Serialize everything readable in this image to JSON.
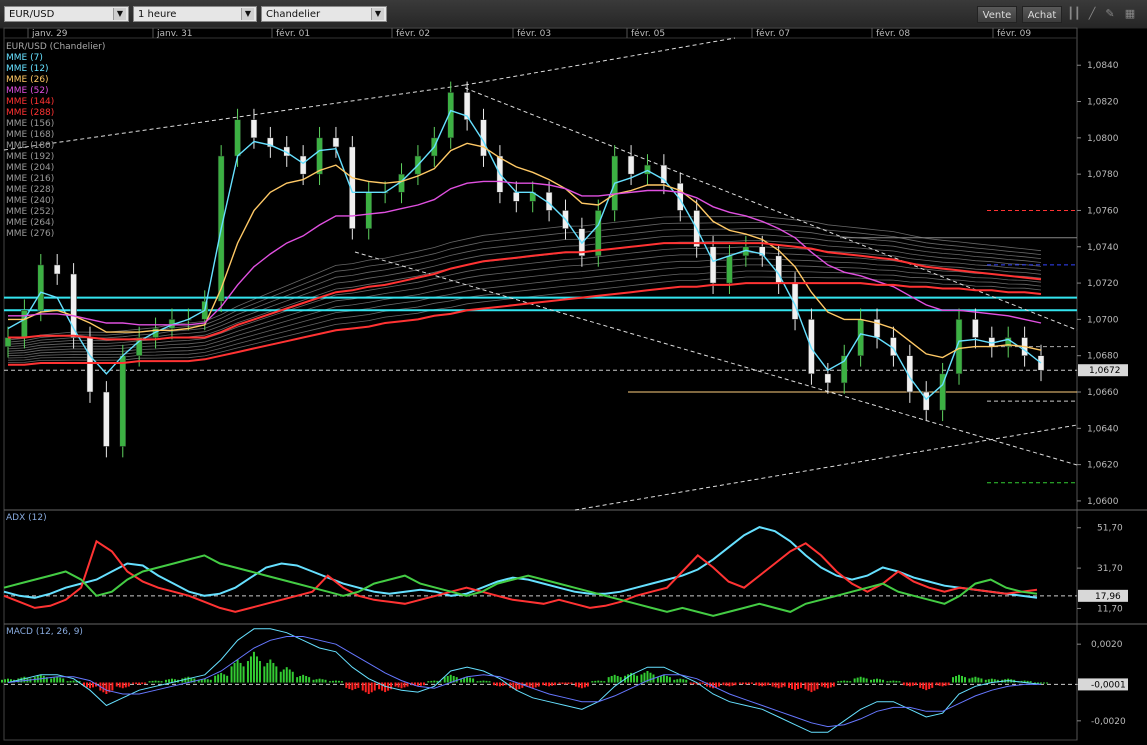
{
  "toolbar": {
    "symbol": "EUR/USD",
    "interval": "1 heure",
    "chart_type": "Chandelier",
    "sell_label": "Vente",
    "buy_label": "Achat",
    "icons": [
      "bars-icon",
      "line-icon",
      "draw-icon",
      "grid-icon"
    ]
  },
  "date_labels": [
    "janv. 29",
    "janv. 31",
    "févr. 01",
    "févr. 02",
    "févr. 03",
    "févr. 05",
    "févr. 07",
    "févr. 08",
    "févr. 09"
  ],
  "legend": {
    "title": "EUR/USD (Chandelier)",
    "items": [
      {
        "label": "MME (7)",
        "color": "#66e0ff"
      },
      {
        "label": "MME (12)",
        "color": "#66e0ff"
      },
      {
        "label": "MME (26)",
        "color": "#ffc966"
      },
      {
        "label": "MME (52)",
        "color": "#e050e0"
      },
      {
        "label": "MME (144)",
        "color": "#ff3333"
      },
      {
        "label": "MME (288)",
        "color": "#ff3333"
      },
      {
        "label": "MME (156)",
        "color": "#999999"
      },
      {
        "label": "MME (168)",
        "color": "#999999"
      },
      {
        "label": "MME (180)",
        "color": "#999999"
      },
      {
        "label": "MME (192)",
        "color": "#999999"
      },
      {
        "label": "MME (204)",
        "color": "#999999"
      },
      {
        "label": "MME (216)",
        "color": "#999999"
      },
      {
        "label": "MME (228)",
        "color": "#999999"
      },
      {
        "label": "MME (240)",
        "color": "#999999"
      },
      {
        "label": "MME (252)",
        "color": "#999999"
      },
      {
        "label": "MME (264)",
        "color": "#999999"
      },
      {
        "label": "MME (276)",
        "color": "#999999"
      }
    ]
  },
  "chart_data": [
    {
      "type": "line",
      "title": "EUR/USD (Chandelier)",
      "ylim": [
        1.0595,
        1.0855
      ],
      "y_ticks": [
        "1,0840",
        "1,0820",
        "1,0800",
        "1,0780",
        "1,0760",
        "1,0740",
        "1,0720",
        "1,0700",
        "1,0680",
        "1,0660",
        "1,0640",
        "1,0620",
        "1,0600"
      ],
      "current_price_label": "1,0672",
      "current_price": 1.0672,
      "closes": [
        1.069,
        1.0705,
        1.073,
        1.0725,
        1.069,
        1.066,
        1.063,
        1.068,
        1.069,
        1.0695,
        1.07,
        1.07,
        1.071,
        1.079,
        1.081,
        1.08,
        1.0795,
        1.079,
        1.078,
        1.08,
        1.0795,
        1.075,
        1.077,
        1.077,
        1.078,
        1.079,
        1.08,
        1.0825,
        1.081,
        1.079,
        1.077,
        1.0765,
        1.077,
        1.076,
        1.075,
        1.0735,
        1.076,
        1.079,
        1.078,
        1.0785,
        1.0775,
        1.076,
        1.074,
        1.072,
        1.0735,
        1.074,
        1.0735,
        1.072,
        1.07,
        1.067,
        1.0665,
        1.068,
        1.07,
        1.069,
        1.068,
        1.066,
        1.065,
        1.067,
        1.07,
        1.069,
        1.0685,
        1.069,
        1.068,
        1.0672
      ],
      "series_ema": [
        {
          "label": "MME (7)",
          "color": "#66e0ff",
          "values": [
            1.0695,
            1.07,
            1.0715,
            1.0712,
            1.0695,
            1.068,
            1.067,
            1.068,
            1.0688,
            1.0693,
            1.0697,
            1.07,
            1.0705,
            1.075,
            1.079,
            1.0798,
            1.0796,
            1.0792,
            1.0786,
            1.0793,
            1.0794,
            1.077,
            1.077,
            1.077,
            1.0776,
            1.0785,
            1.0795,
            1.0815,
            1.0812,
            1.0798,
            1.078,
            1.077,
            1.077,
            1.0764,
            1.0755,
            1.0742,
            1.0752,
            1.0775,
            1.0778,
            1.0782,
            1.0777,
            1.0766,
            1.075,
            1.0732,
            1.0735,
            1.0738,
            1.0736,
            1.0725,
            1.0708,
            1.0684,
            1.0672,
            1.0677,
            1.0692,
            1.069,
            1.0684,
            1.0668,
            1.0656,
            1.0664,
            1.0688,
            1.0689,
            1.0687,
            1.0689,
            1.0683,
            1.0676
          ]
        },
        {
          "label": "MME (26)",
          "color": "#ffc966",
          "values": [
            1.07,
            1.07,
            1.0704,
            1.0705,
            1.0702,
            1.0698,
            1.0693,
            1.0693,
            1.0693,
            1.0694,
            1.0694,
            1.0695,
            1.0697,
            1.0717,
            1.0742,
            1.076,
            1.077,
            1.0775,
            1.0777,
            1.0782,
            1.0785,
            1.0778,
            1.0776,
            1.0775,
            1.0776,
            1.0779,
            1.0783,
            1.0793,
            1.0797,
            1.0795,
            1.0789,
            1.0784,
            1.0781,
            1.0777,
            1.0772,
            1.0764,
            1.0763,
            1.0769,
            1.0771,
            1.0774,
            1.0774,
            1.0771,
            1.0764,
            1.0754,
            1.0749,
            1.0747,
            1.0744,
            1.0738,
            1.0729,
            1.0715,
            1.0704,
            1.07,
            1.07,
            1.0698,
            1.0695,
            1.0688,
            1.0681,
            1.0679,
            1.0684,
            1.0685,
            1.0685,
            1.0686,
            1.0685,
            1.0683
          ]
        },
        {
          "label": "MME (52)",
          "color": "#e050e0",
          "values": [
            1.0702,
            1.0702,
            1.0703,
            1.0703,
            1.0702,
            1.07,
            1.0698,
            1.0698,
            1.0697,
            1.0697,
            1.0697,
            1.0697,
            1.0698,
            1.0707,
            1.0719,
            1.0729,
            1.0736,
            1.0742,
            1.0746,
            1.0752,
            1.0757,
            1.0757,
            1.0758,
            1.0759,
            1.0761,
            1.0763,
            1.0766,
            1.0772,
            1.0775,
            1.0776,
            1.0776,
            1.0775,
            1.0775,
            1.0774,
            1.0772,
            1.0768,
            1.0768,
            1.0769,
            1.077,
            1.0771,
            1.0771,
            1.077,
            1.0767,
            1.0762,
            1.0759,
            1.0757,
            1.0754,
            1.075,
            1.0745,
            1.0737,
            1.073,
            1.0726,
            1.0724,
            1.0721,
            1.0718,
            1.0713,
            1.0708,
            1.0705,
            1.0705,
            1.0704,
            1.0703,
            1.0702,
            1.07,
            1.0698
          ]
        },
        {
          "label": "MME (144)",
          "color": "#ff3333",
          "values": [
            1.069,
            1.069,
            1.0691,
            1.0691,
            1.0691,
            1.069,
            1.0689,
            1.0689,
            1.0689,
            1.0689,
            1.069,
            1.069,
            1.069,
            1.0693,
            1.0697,
            1.07,
            1.0703,
            1.0706,
            1.0709,
            1.0712,
            1.0715,
            1.0716,
            1.0718,
            1.0719,
            1.0721,
            1.0723,
            1.0725,
            1.0728,
            1.073,
            1.0732,
            1.0733,
            1.0734,
            1.0735,
            1.0736,
            1.0737,
            1.0737,
            1.0738,
            1.0739,
            1.074,
            1.0741,
            1.0742,
            1.0742,
            1.0742,
            1.0742,
            1.0742,
            1.0742,
            1.0742,
            1.0741,
            1.074,
            1.0739,
            1.0737,
            1.0736,
            1.0735,
            1.0734,
            1.0733,
            1.0731,
            1.0729,
            1.0728,
            1.0727,
            1.0726,
            1.0725,
            1.0724,
            1.0723,
            1.0722
          ]
        },
        {
          "label": "MME (288)",
          "color": "#ff3333",
          "values": [
            1.0675,
            1.0675,
            1.0676,
            1.0676,
            1.0676,
            1.0676,
            1.0676,
            1.0676,
            1.0677,
            1.0677,
            1.0677,
            1.0677,
            1.0678,
            1.068,
            1.0682,
            1.0684,
            1.0686,
            1.0688,
            1.069,
            1.0692,
            1.0694,
            1.0695,
            1.0696,
            1.0698,
            1.0699,
            1.07,
            1.0702,
            1.0703,
            1.0705,
            1.0706,
            1.0707,
            1.0708,
            1.0709,
            1.071,
            1.0711,
            1.0712,
            1.0713,
            1.0714,
            1.0715,
            1.0716,
            1.0717,
            1.0718,
            1.0718,
            1.0719,
            1.0719,
            1.072,
            1.072,
            1.072,
            1.072,
            1.072,
            1.072,
            1.072,
            1.072,
            1.0719,
            1.0719,
            1.0718,
            1.0718,
            1.0717,
            1.0717,
            1.0716,
            1.0716,
            1.0715,
            1.0715,
            1.0714
          ]
        }
      ],
      "horizontal_levels": [
        {
          "value": 1.0712,
          "color": "#33e5f0",
          "style": "solid"
        },
        {
          "value": 1.0705,
          "color": "#33e5f0",
          "style": "solid"
        },
        {
          "value": 1.0745,
          "color": "#888888",
          "style": "solid"
        },
        {
          "value": 1.066,
          "color": "#ffd080",
          "style": "solid"
        },
        {
          "value": 1.0672,
          "color": "#cccccc",
          "style": "dashed"
        },
        {
          "value": 1.076,
          "color": "#ff3333",
          "style": "dashed"
        },
        {
          "value": 1.073,
          "color": "#3344ff",
          "style": "dashed"
        },
        {
          "value": 1.0685,
          "color": "#aaaaaa",
          "style": "dashed"
        },
        {
          "value": 1.0655,
          "color": "#cccccc",
          "style": "dashed"
        },
        {
          "value": 1.061,
          "color": "#33cc33",
          "style": "dashed"
        }
      ]
    },
    {
      "type": "line",
      "title": "ADX (12)",
      "ylim": [
        4,
        60
      ],
      "y_ticks": [
        "51,70",
        "31,70",
        "11,70"
      ],
      "current_value_label": "17,96",
      "series": [
        {
          "color": "#66e0ff",
          "values": [
            20,
            18,
            17,
            19,
            22,
            24,
            26,
            30,
            34,
            33,
            28,
            24,
            20,
            18,
            19,
            22,
            27,
            32,
            34,
            33,
            30,
            27,
            24,
            22,
            20,
            19,
            20,
            21,
            20,
            18,
            19,
            22,
            25,
            27,
            26,
            24,
            22,
            20,
            19,
            19,
            20,
            22,
            24,
            26,
            28,
            31,
            36,
            42,
            48,
            52,
            50,
            45,
            38,
            32,
            28,
            26,
            28,
            32,
            30,
            27,
            25,
            23,
            22,
            21,
            20,
            19,
            18,
            17
          ]
        },
        {
          "color": "#ff3333",
          "values": [
            18,
            15,
            12,
            13,
            16,
            22,
            45,
            40,
            30,
            25,
            22,
            20,
            18,
            15,
            12,
            10,
            12,
            14,
            16,
            18,
            20,
            28,
            22,
            18,
            16,
            15,
            14,
            16,
            18,
            20,
            22,
            20,
            18,
            16,
            15,
            14,
            16,
            14,
            12,
            13,
            15,
            18,
            20,
            22,
            30,
            38,
            32,
            25,
            22,
            28,
            34,
            40,
            44,
            38,
            30,
            24,
            20,
            24,
            30,
            25,
            22,
            20,
            22,
            21,
            20,
            19,
            20,
            21
          ]
        },
        {
          "color": "#44cc44",
          "values": [
            22,
            24,
            26,
            28,
            30,
            26,
            18,
            20,
            26,
            30,
            32,
            34,
            36,
            38,
            34,
            32,
            30,
            28,
            26,
            24,
            22,
            20,
            18,
            20,
            24,
            26,
            28,
            24,
            22,
            20,
            18,
            20,
            24,
            26,
            28,
            26,
            24,
            22,
            20,
            18,
            16,
            14,
            12,
            10,
            12,
            10,
            8,
            10,
            12,
            14,
            12,
            10,
            14,
            16,
            18,
            20,
            22,
            24,
            20,
            18,
            16,
            14,
            18,
            24,
            26,
            22,
            20,
            19
          ]
        }
      ]
    },
    {
      "type": "bar",
      "title": "MACD (12, 26, 9)",
      "ylim": [
        -0.003,
        0.003
      ],
      "y_ticks": [
        "0,0020",
        "-0,0001",
        "-0,0020"
      ],
      "current_value_label": "-0,0001",
      "histogram": [
        0.0002,
        0.0003,
        0.0004,
        0.0003,
        0.0001,
        -0.0003,
        -0.0006,
        -0.0003,
        -0.0001,
        0.0001,
        0.0002,
        0.0003,
        0.0002,
        0.0005,
        0.0012,
        0.0016,
        0.0012,
        0.0008,
        0.0004,
        0.0002,
        0.0001,
        -0.0004,
        -0.0006,
        -0.0005,
        -0.0003,
        -0.0002,
        0.0001,
        0.0004,
        0.0003,
        0.0001,
        -0.0002,
        -0.0004,
        -0.0003,
        -0.0002,
        -0.0001,
        -0.0003,
        0.0001,
        0.0004,
        0.0005,
        0.0006,
        0.0004,
        0.0002,
        -0.0001,
        -0.0003,
        -0.0002,
        -0.0001,
        -0.0002,
        -0.0003,
        -0.0004,
        -0.0005,
        -0.0003,
        0.0001,
        0.0003,
        0.0002,
        0.0001,
        -0.0002,
        -0.0004,
        -0.0002,
        0.0004,
        0.0003,
        0.0002,
        0.0002,
        0.0001,
        0.0
      ],
      "macd": [
        0.0,
        0.0002,
        0.0004,
        0.0004,
        0.0002,
        -0.0004,
        -0.0012,
        -0.0008,
        -0.0004,
        -0.0002,
        0.0,
        0.0002,
        0.0004,
        0.0012,
        0.0022,
        0.0028,
        0.0028,
        0.0026,
        0.0022,
        0.0018,
        0.0016,
        0.0008,
        0.0002,
        -0.0002,
        -0.0004,
        -0.0005,
        -0.0002,
        0.0006,
        0.0008,
        0.0006,
        0.0002,
        -0.0004,
        -0.0008,
        -0.001,
        -0.0012,
        -0.0014,
        -0.001,
        -0.0002,
        0.0004,
        0.0008,
        0.0008,
        0.0004,
        0.0,
        -0.0006,
        -0.001,
        -0.0012,
        -0.0014,
        -0.0018,
        -0.0022,
        -0.0026,
        -0.0026,
        -0.002,
        -0.0014,
        -0.001,
        -0.001,
        -0.0014,
        -0.0018,
        -0.0016,
        -0.0006,
        -0.0002,
        0.0,
        0.0001,
        0.0,
        -0.0001
      ],
      "signal": [
        0.0,
        0.0001,
        0.0002,
        0.0003,
        0.0003,
        0.0001,
        -0.0004,
        -0.0006,
        -0.0006,
        -0.0004,
        -0.0002,
        0.0,
        0.0002,
        0.0006,
        0.0012,
        0.0018,
        0.0022,
        0.0024,
        0.0024,
        0.0022,
        0.002,
        0.0015,
        0.001,
        0.0005,
        0.0001,
        -0.0002,
        -0.0003,
        0.0,
        0.0003,
        0.0004,
        0.0003,
        0.0,
        -0.0003,
        -0.0006,
        -0.0008,
        -0.001,
        -0.001,
        -0.0007,
        -0.0003,
        0.0001,
        0.0004,
        0.0004,
        0.0002,
        -0.0002,
        -0.0006,
        -0.0009,
        -0.0012,
        -0.0015,
        -0.0018,
        -0.0021,
        -0.0023,
        -0.0022,
        -0.0019,
        -0.0015,
        -0.0013,
        -0.0013,
        -0.0015,
        -0.0015,
        -0.0011,
        -0.0007,
        -0.0004,
        -0.0002,
        -0.0001,
        -0.0001
      ],
      "colors": {
        "positive": "#33cc33",
        "negative": "#ff2222",
        "macd": "#66e0ff",
        "signal": "#6677ff"
      }
    }
  ]
}
